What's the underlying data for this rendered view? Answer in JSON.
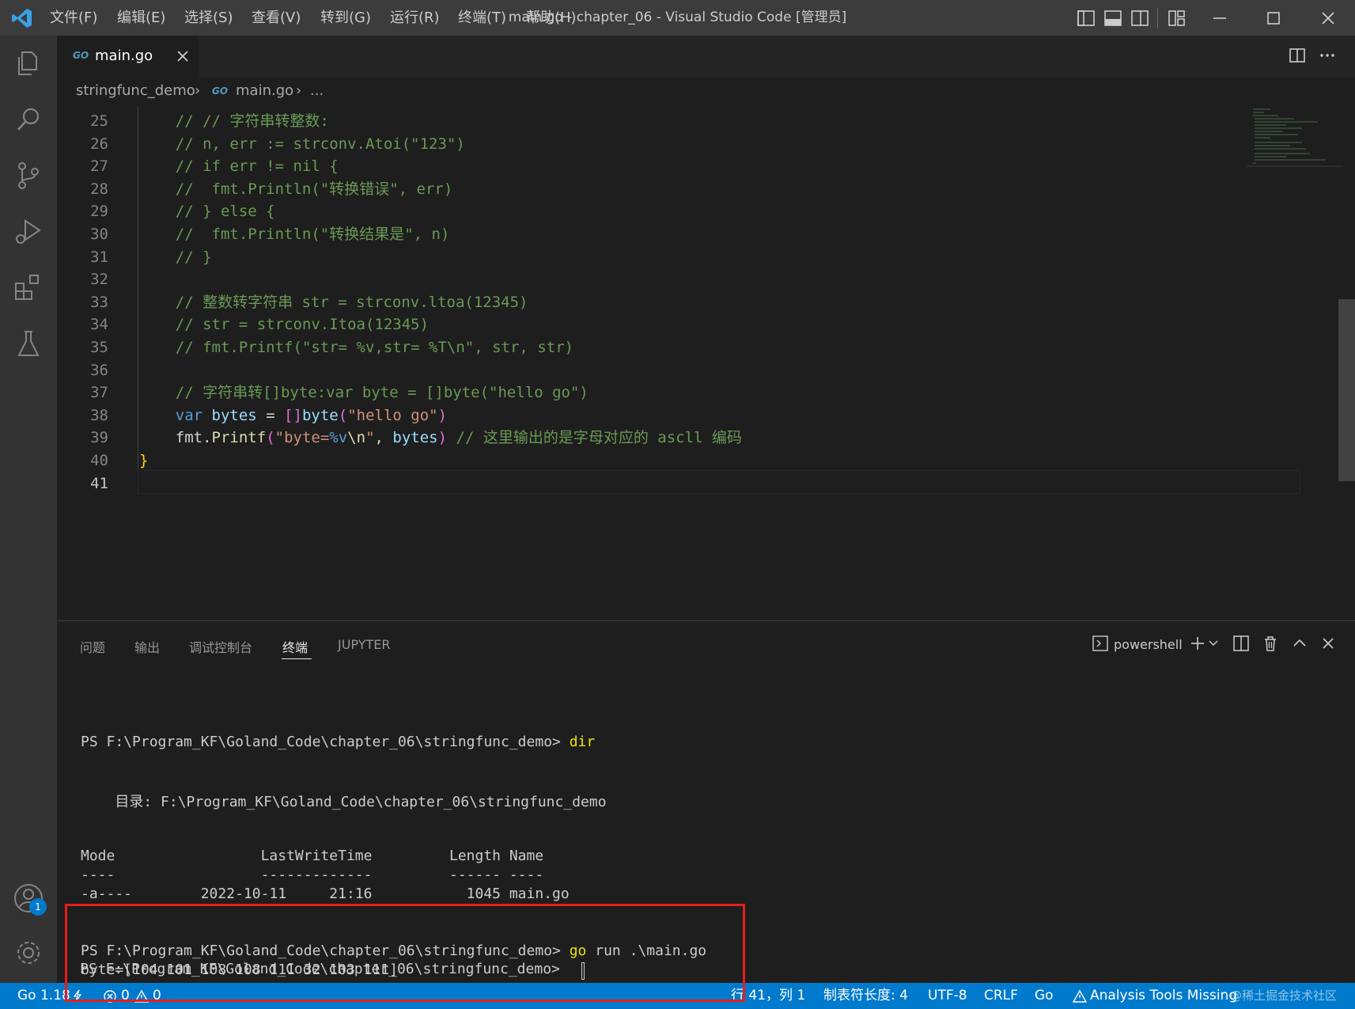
{
  "colors": {
    "accent": "#007acc",
    "highlight_box": "#e81c1c",
    "vscode_logo": "#3ba0e6"
  },
  "menu": [
    "文件(F)",
    "编辑(E)",
    "选择(S)",
    "查看(V)",
    "转到(G)",
    "运行(R)",
    "终端(T)",
    "帮助(H)"
  ],
  "window_title": "main.go - chapter_06 - Visual Studio Code [管理员]",
  "tab": {
    "icon_text": "GO",
    "label": "main.go"
  },
  "breadcrumb": {
    "folder": "stringfunc_demo",
    "file": "main.go",
    "more": "..."
  },
  "editor": {
    "lines": [
      {
        "n": "25",
        "t": "    // // 字符串转整数:"
      },
      {
        "n": "26",
        "t": "    // n, err := strconv.Atoi(\"123\")"
      },
      {
        "n": "27",
        "t": "    // if err != nil {"
      },
      {
        "n": "28",
        "t": "    //  fmt.Println(\"转换错误\", err)"
      },
      {
        "n": "29",
        "t": "    // } else {"
      },
      {
        "n": "30",
        "t": "    //  fmt.Println(\"转换结果是\", n)"
      },
      {
        "n": "31",
        "t": "    // }"
      },
      {
        "n": "32",
        "t": ""
      },
      {
        "n": "33",
        "t": "    // 整数转字符串 str = strconv.ltoa(12345)"
      },
      {
        "n": "34",
        "t": "    // str = strconv.Itoa(12345)"
      },
      {
        "n": "35",
        "t": "    // fmt.Printf(\"str= %v,str= %T\\n\", str, str)"
      },
      {
        "n": "36",
        "t": ""
      },
      {
        "n": "37",
        "t": "    // 字符串转[]byte:var byte = []byte(\"hello go\")"
      },
      {
        "n": "38",
        "t": ""
      },
      {
        "n": "39",
        "t": ""
      },
      {
        "n": "40",
        "t": ""
      },
      {
        "n": "41",
        "t": ""
      }
    ],
    "line38": {
      "kw": "var",
      "ident": "bytes",
      "op": " = ",
      "bracket": "[]",
      "type": "byte",
      "open": "(",
      "str": "\"hello go\"",
      "close": ")"
    },
    "line39": {
      "pkg": "fmt",
      "dot": ".",
      "fn": "Printf",
      "open": "(",
      "str1": "\"byte=",
      "fmt": "%v",
      "esc": "\\n",
      "str2": "\"",
      "comma": ", ",
      "arg": "bytes",
      "close": ")",
      "comment": " // 这里输出的是字母对应的 ascll 编码"
    },
    "line40": {
      "brace": "}"
    }
  },
  "panel": {
    "tabs": [
      "问题",
      "输出",
      "调试控制台",
      "终端",
      "JUPYTER"
    ],
    "active_tab": "终端",
    "shell_label": "powershell"
  },
  "terminal": {
    "prompt1": "PS F:\\Program_KF\\Goland_Code\\chapter_06\\stringfunc_demo> ",
    "cmd1": "dir",
    "dir_line": "    目录: F:\\Program_KF\\Goland_Code\\chapter_06\\stringfunc_demo",
    "header": "Mode                 LastWriteTime         Length Name",
    "separator": "----                 -------------         ------ ----",
    "row": "-a----        2022-10-11     21:16           1045 main.go",
    "prompt2": "PS F:\\Program_KF\\Goland_Code\\chapter_06\\stringfunc_demo> ",
    "cmd2_go": "go",
    "cmd2_rest": " run .\\main.go",
    "output": "byte=[104 101 108 108 111 32 103 111]",
    "prompt3": "PS F:\\Program_KF\\Goland_Code\\chapter_06\\stringfunc_demo> "
  },
  "accounts_badge": "1",
  "statusbar": {
    "go_version": "Go 1.18",
    "errors": "0",
    "warnings": "0",
    "position": "行 41，列 1",
    "tab_size": "制表符长度: 4",
    "encoding": "UTF-8",
    "eol": "CRLF",
    "language": "Go",
    "analysis": "Analysis Tools Missing",
    "watermark": "@稀土掘金技术社区"
  }
}
